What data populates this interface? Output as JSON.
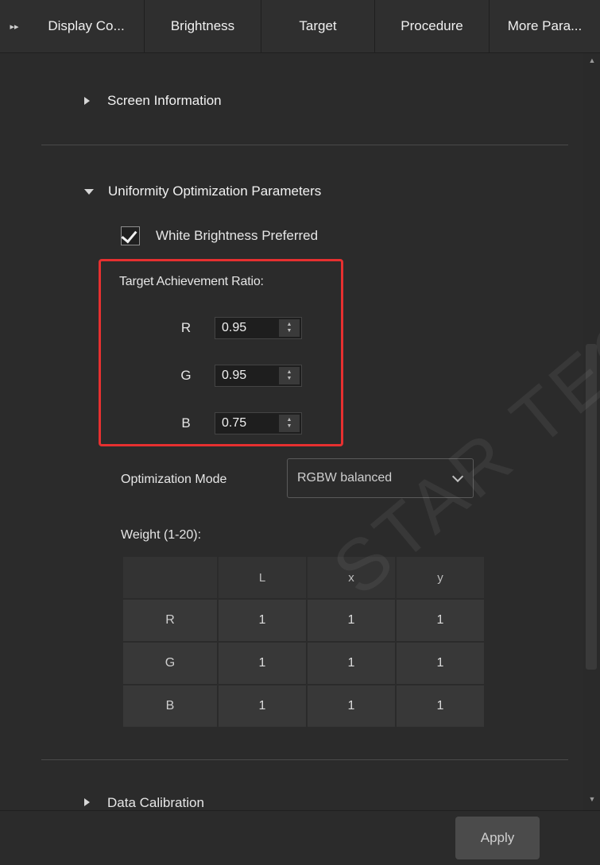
{
  "tabs": {
    "expander_icon": "double-chevron-right-icon",
    "items": [
      "Display Co...",
      "Brightness",
      "Target",
      "Procedure",
      "More Para..."
    ]
  },
  "sections": {
    "screen_info": "Screen Information",
    "uniformity": "Uniformity Optimization Parameters",
    "data_calibration": "Data Calibration"
  },
  "uniformity": {
    "white_brightness_label": "White Brightness Preferred",
    "white_brightness_checked": true,
    "target_ratio_label": "Target Achievement Ratio:",
    "ratios": [
      {
        "channel": "R",
        "value": "0.95"
      },
      {
        "channel": "G",
        "value": "0.95"
      },
      {
        "channel": "B",
        "value": "0.75"
      }
    ],
    "opt_mode_label": "Optimization Mode",
    "opt_mode_value": "RGBW balanced",
    "weight_label": "Weight (1-20):",
    "weight_table": {
      "columns": [
        "",
        "L",
        "x",
        "y"
      ],
      "rows": [
        [
          "R",
          "1",
          "1",
          "1"
        ],
        [
          "G",
          "1",
          "1",
          "1"
        ],
        [
          "B",
          "1",
          "1",
          "1"
        ]
      ]
    }
  },
  "footer": {
    "apply_label": "Apply"
  },
  "watermark": "STAR TECH",
  "colors": {
    "background": "#2b2b2b",
    "highlight": "#e63030",
    "text": "#e6e6e6"
  }
}
